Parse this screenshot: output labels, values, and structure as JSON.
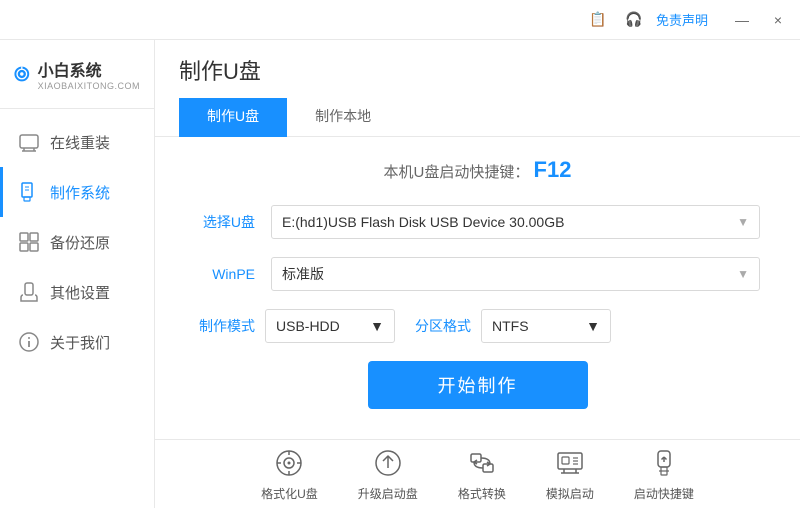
{
  "titlebar": {
    "free_text": "免责声明",
    "minimize": "—",
    "close": "×",
    "icon1": "📋",
    "icon2": "🎧"
  },
  "sidebar": {
    "logo_title": "小白系统",
    "logo_subtitle": "XIAOBAIXITONG.COM",
    "items": [
      {
        "id": "online-reinstall",
        "label": "在线重装",
        "icon": "🖥"
      },
      {
        "id": "make-system",
        "label": "制作系统",
        "icon": "💾",
        "active": true
      },
      {
        "id": "backup-restore",
        "label": "备份还原",
        "icon": "📋"
      },
      {
        "id": "other-settings",
        "label": "其他设置",
        "icon": "🔒"
      },
      {
        "id": "about-us",
        "label": "关于我们",
        "icon": "ℹ"
      }
    ]
  },
  "content": {
    "title": "制作U盘",
    "tabs": [
      {
        "id": "make-udisk",
        "label": "制作U盘",
        "active": true
      },
      {
        "id": "make-local",
        "label": "制作本地",
        "active": false
      }
    ],
    "shortcut_label": "本机U盘启动快捷键：",
    "shortcut_key": "F12",
    "form": {
      "select_udisk_label": "选择U盘",
      "select_udisk_value": "E:(hd1)USB Flash Disk USB Device 30.00GB",
      "winpe_label": "WinPE",
      "winpe_value": "标准版",
      "make_mode_label": "制作模式",
      "make_mode_value": "USB-HDD",
      "partition_label": "分区格式",
      "partition_value": "NTFS",
      "start_btn": "开始制作"
    }
  },
  "bottom_tools": [
    {
      "id": "format-udisk",
      "label": "格式化U盘",
      "icon": "⊙"
    },
    {
      "id": "upgrade-boot",
      "label": "升级启动盘",
      "icon": "⊕"
    },
    {
      "id": "format-convert",
      "label": "格式转换",
      "icon": "⇄"
    },
    {
      "id": "simulate-boot",
      "label": "模拟启动",
      "icon": "⊞"
    },
    {
      "id": "boot-shortcut",
      "label": "启动快捷键",
      "icon": "🔒"
    }
  ],
  "colors": {
    "accent": "#1890ff",
    "sidebar_bg": "#fff",
    "border": "#e8e8e8"
  }
}
